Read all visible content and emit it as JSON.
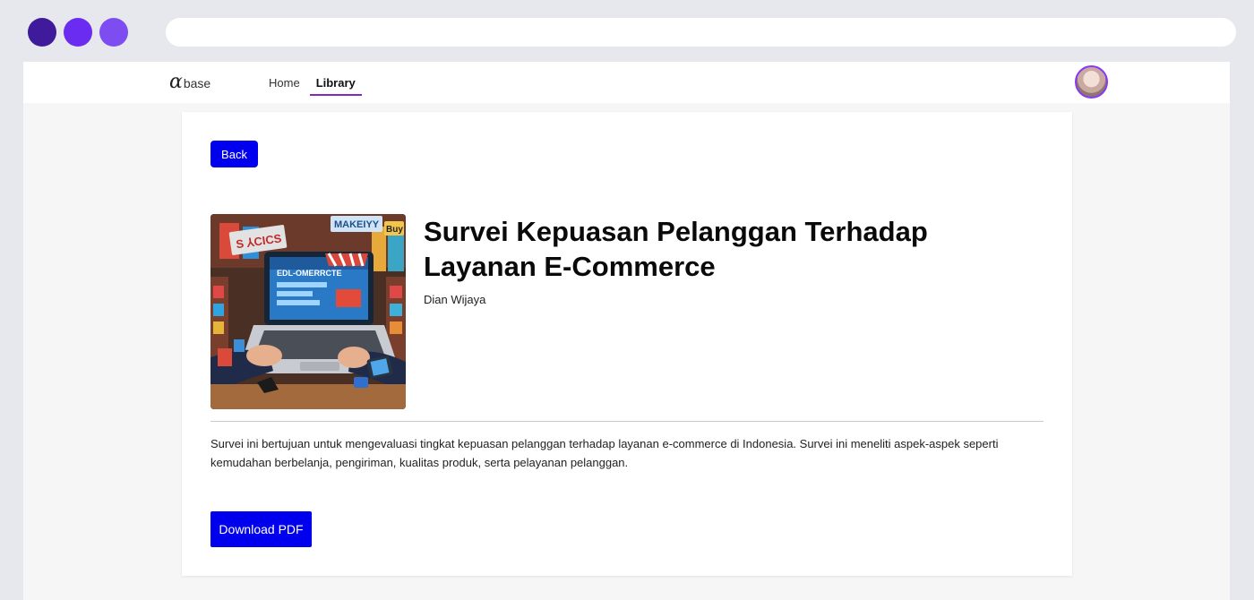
{
  "browser": {
    "address": ""
  },
  "nav": {
    "logo_alpha": "α",
    "logo_text": "base",
    "links": [
      {
        "label": "Home",
        "active": false
      },
      {
        "label": "Library",
        "active": true
      }
    ],
    "accent_color": "#7b2cbf"
  },
  "detail": {
    "back_label": "Back",
    "title": "Survei Kepuasan Pelanggan Terhadap Layanan E-Commerce",
    "author": "Dian Wijaya",
    "description": "Survei ini bertujuan untuk mengevaluasi tingkat kepuasan pelanggan terhadap layanan e-commerce di Indonesia. Survei ini meneliti aspek-aspek seperti kemudahan berbelanja, pengiriman, kualitas produk, serta pelayanan pelanggan.",
    "download_label": "Download PDF",
    "button_color": "#0000ee",
    "cover": {
      "sign_left": "S ⅄CICS",
      "sign_mid": "MAKEIYY",
      "sign_right": "Buy",
      "screen_text": "EDL-OMERRCTE"
    }
  }
}
